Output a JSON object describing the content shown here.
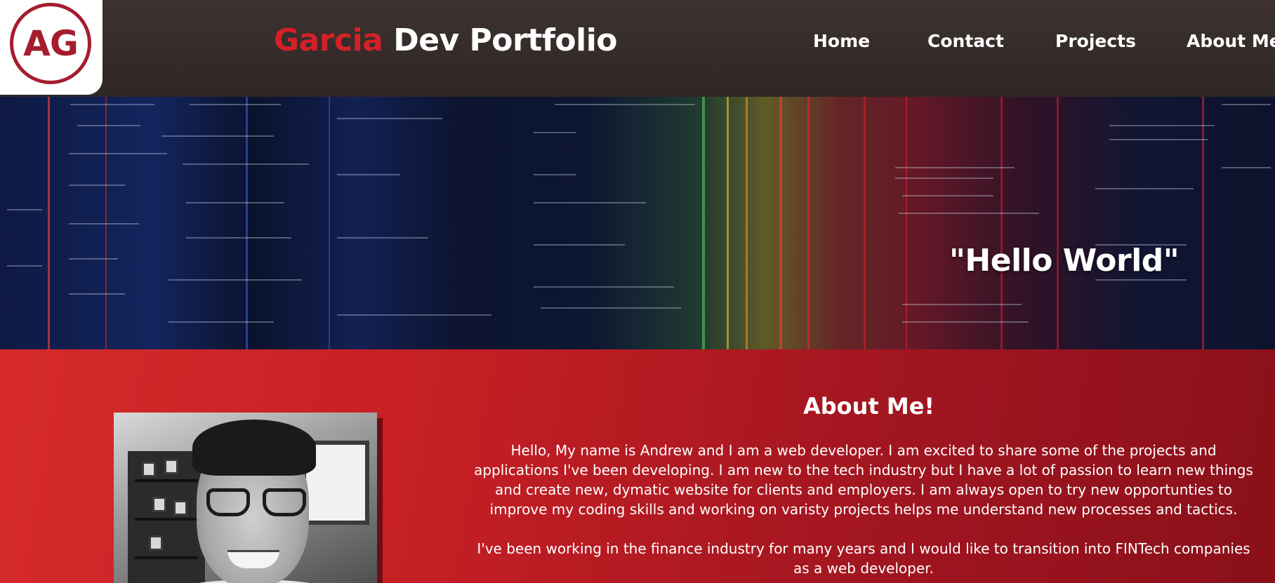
{
  "header": {
    "logo_text": "AG",
    "title_accent": "Garcia",
    "title_rest": " Dev Portfolio",
    "nav": [
      {
        "label": "Home"
      },
      {
        "label": "Contact"
      },
      {
        "label": "Projects"
      },
      {
        "label": "About Me"
      }
    ]
  },
  "hero": {
    "headline": "\"Hello World\""
  },
  "about": {
    "title": "About Me!",
    "paragraphs": [
      "Hello, My name is Andrew and I am a web developer. I am excited to share some of the projects and applications I've been developing. I am new to the tech industry but I have a lot of passion to learn new things and create new, dymatic website for clients and employers. I am always open to try new opportunties to improve my coding skills and working on varisty projects helps me understand new processes and tactics.",
      "I've been working in the finance industry for many years and I would like to transition into FINTech companies as a web developer."
    ]
  },
  "colors": {
    "header_bg": "#3d3230",
    "brand_red": "#d42027",
    "logo_red": "#a41d2e",
    "section_red": "#c41f24",
    "text": "#ffffff"
  },
  "icons": {
    "logo": "ag-monogram-logo",
    "photo": "profile-photo"
  }
}
